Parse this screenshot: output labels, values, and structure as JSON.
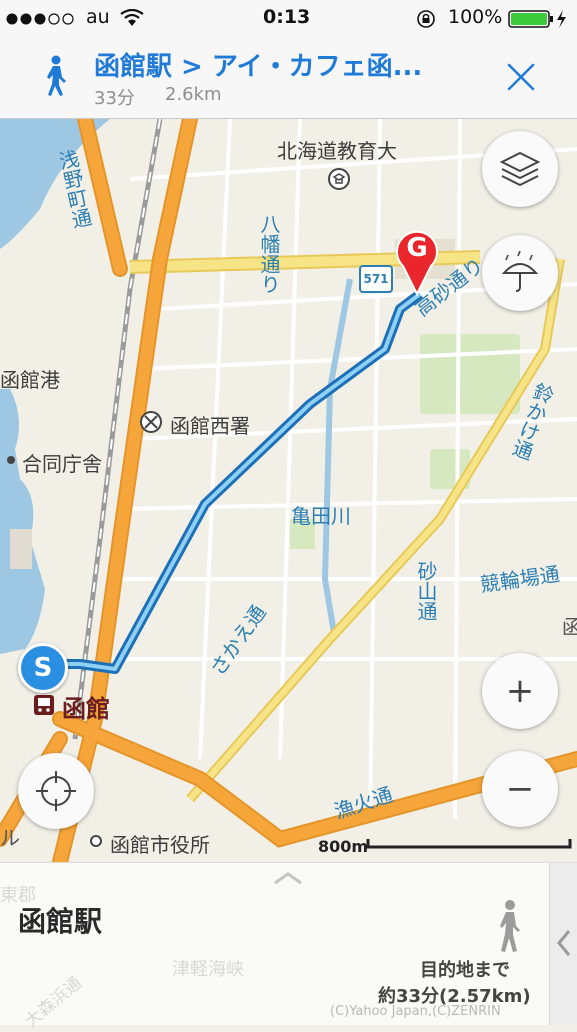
{
  "status_bar": {
    "carrier": "au",
    "time": "0:13",
    "battery": "100%"
  },
  "header": {
    "route_title": "函館駅 > アイ・カフェ函...",
    "duration": "33分",
    "distance": "2.6km"
  },
  "map": {
    "labels": {
      "university": "北海道教育大",
      "hakodate_port": "函館港",
      "nishi_police": "函館西署",
      "joint_office": "合同庁舎",
      "kameda_river": "亀田川",
      "station_name": "函館",
      "city_hall": "函館市役所",
      "asano_dori": "浅野町通",
      "hachiman_dori": "八幡通り",
      "takasago_dori": "高砂通り",
      "suzukake_dori": "鈴かけ通",
      "sakae_dori": "さかえ通",
      "sunayama_dori": "砂山通",
      "keirinjo_dori": "競輪場通",
      "isaribi_dori": "漁火通",
      "edge_ru": "ル",
      "edge_ha": "函"
    },
    "route_shield": "571",
    "start_marker": "S",
    "goal_marker": "G",
    "scale_label": "800m",
    "controls": {
      "zoom_in": "+",
      "zoom_out": "−"
    }
  },
  "bottom_sheet": {
    "place_name": "函館駅",
    "to_destination": "目的地まで",
    "estimate": "約33分(2.57km)",
    "faded_labels": {
      "higashi_gun": "東郡",
      "omori": "大森浜通",
      "tsugaru": "津軽海峡"
    },
    "copyright": "(C)Yahoo Japan,(C)ZENRIN"
  },
  "colors": {
    "accent": "#1f7ad8",
    "route": "#2a8fd8",
    "main_road": "#f6a53a",
    "yellow_road": "#f3e07a",
    "water": "#9dc7e3",
    "goal_marker": "#e8262b",
    "start_marker": "#2a8fe0"
  }
}
